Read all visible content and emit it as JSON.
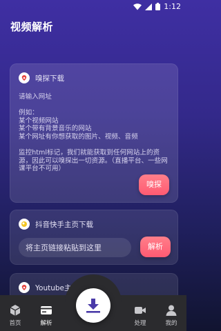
{
  "status_bar": {
    "time": "1:12"
  },
  "app_bar": {
    "title": "视频解析"
  },
  "card_sniff": {
    "title": "嗅探下载",
    "body": "请输入网址\n\n例如：\n某个视频网站\n某个带有背景音乐的网站\n某个网址有你想获取的图片、视频、音频\n\n监控html标记，我们就能获取到任何网站上的资源，因此可以嗅探出一切资源。（直播平台、一些网课平台不可用）",
    "button": "嗅探"
  },
  "card_douyin": {
    "title": "抖音快手主页下载",
    "placeholder": "将主页链接粘贴到这里",
    "button": "解析"
  },
  "card_youtube": {
    "title": "Youtube主页下载"
  },
  "bottom_nav": {
    "items": [
      {
        "label": "首页",
        "icon": "cube-icon"
      },
      {
        "label": "解析",
        "icon": "card-icon"
      },
      {
        "label": "处理",
        "icon": "video-camera-icon"
      },
      {
        "label": "我的",
        "icon": "person-icon"
      }
    ],
    "fab_icon": "download-icon"
  },
  "colors": {
    "accent": "#ff6679",
    "nav_bg": "#2b2b2e",
    "fab_arrow": "#4a3aa8"
  }
}
